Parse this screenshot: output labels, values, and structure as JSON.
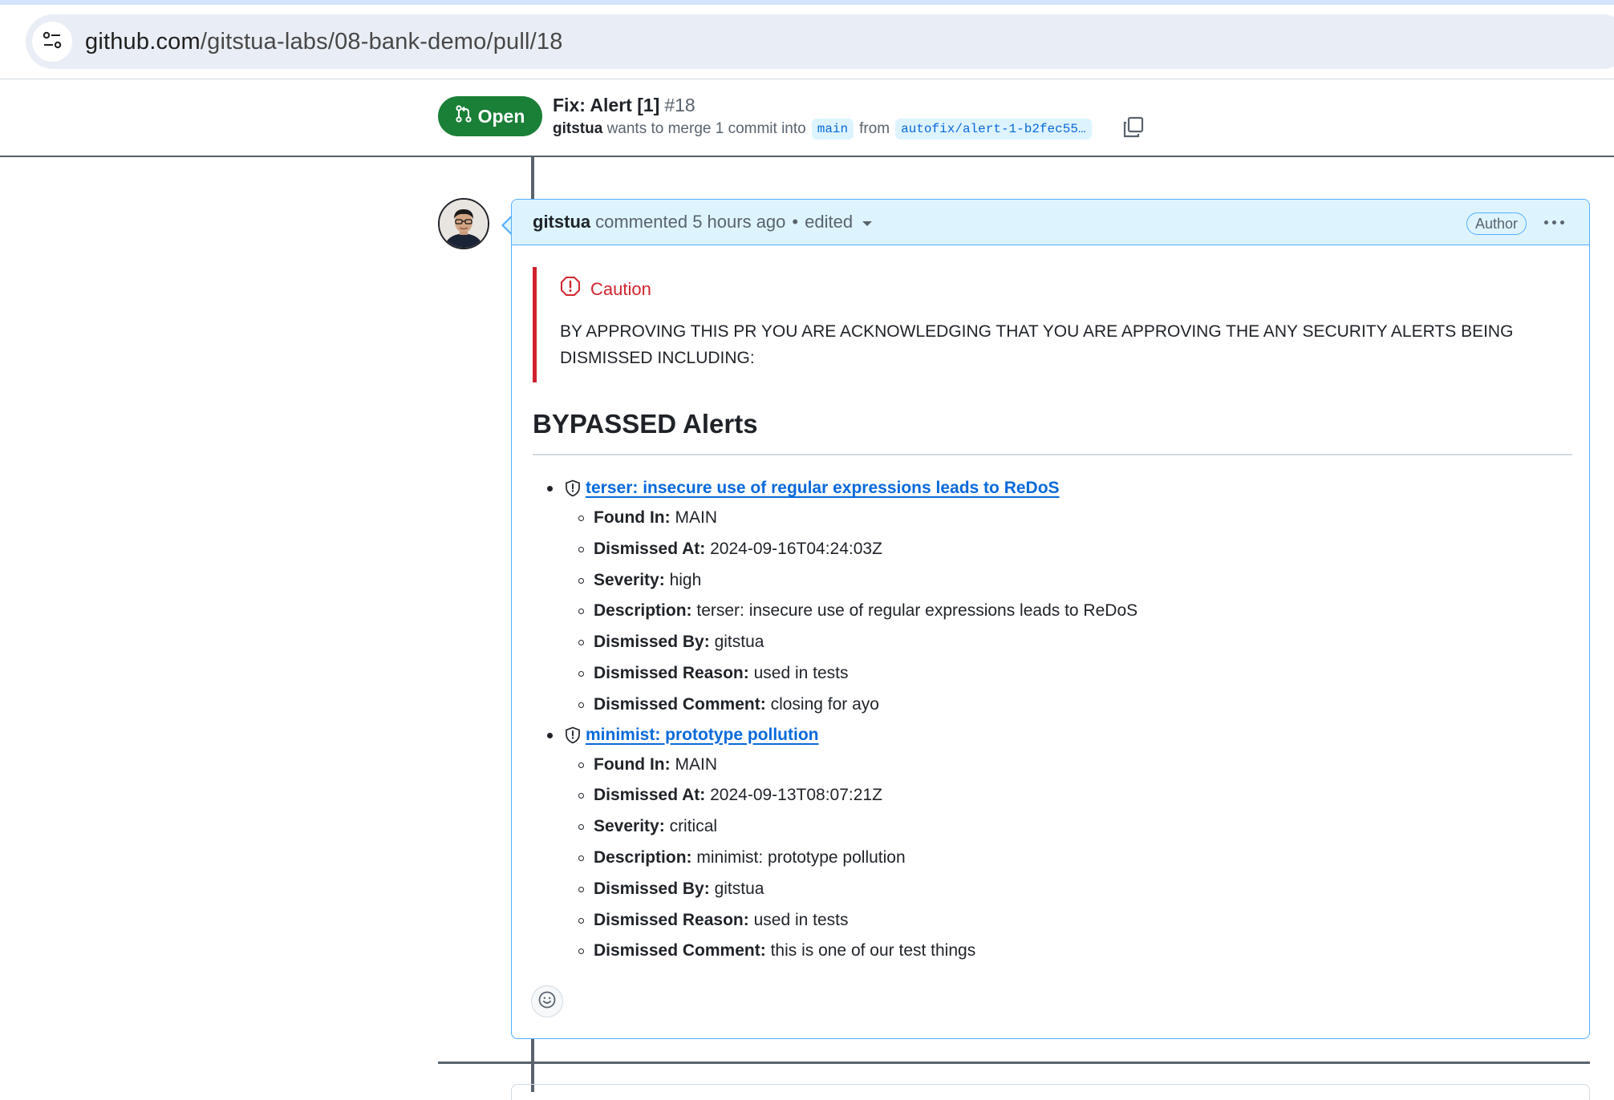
{
  "browser": {
    "url_host": "github.com",
    "url_path": "/gitstua-labs/08-bank-demo/pull/18"
  },
  "pr": {
    "state": "Open",
    "title": "Fix: Alert [1]",
    "number": "#18",
    "author": "gitstua",
    "merge_text": "wants to merge 1 commit into",
    "base_branch": "main",
    "from_text": "from",
    "head_branch": "autofix/alert-1-b2fec55…"
  },
  "comment": {
    "author": "gitstua",
    "action": "commented",
    "time": "5 hours ago",
    "separator": "•",
    "edited": "edited",
    "badge": "Author",
    "caution_title": "Caution",
    "caution_body": "BY APPROVING THIS PR YOU ARE ACKNOWLEDGING THAT YOU ARE APPROVING THE ANY SECURITY ALERTS BEING DISMISSED INCLUDING:",
    "heading": "BYPASSED Alerts",
    "alerts": [
      {
        "title": "terser: insecure use of regular expressions leads to ReDoS",
        "fields": [
          {
            "k": "Found In:",
            "v": "MAIN"
          },
          {
            "k": "Dismissed At:",
            "v": "2024-09-16T04:24:03Z"
          },
          {
            "k": "Severity:",
            "v": "high"
          },
          {
            "k": "Description:",
            "v": "terser: insecure use of regular expressions leads to ReDoS"
          },
          {
            "k": "Dismissed By:",
            "v": "gitstua"
          },
          {
            "k": "Dismissed Reason:",
            "v": "used in tests"
          },
          {
            "k": "Dismissed Comment:",
            "v": "closing for ayo"
          }
        ]
      },
      {
        "title": "minimist: prototype pollution",
        "fields": [
          {
            "k": "Found In:",
            "v": "MAIN"
          },
          {
            "k": "Dismissed At:",
            "v": "2024-09-13T08:07:21Z"
          },
          {
            "k": "Severity:",
            "v": "critical"
          },
          {
            "k": "Description:",
            "v": "minimist: prototype pollution"
          },
          {
            "k": "Dismissed By:",
            "v": "gitstua"
          },
          {
            "k": "Dismissed Reason:",
            "v": "used in tests"
          },
          {
            "k": "Dismissed Comment:",
            "v": "this is one of our test things"
          }
        ]
      }
    ]
  },
  "icons": {
    "site_info": "tune-icon",
    "state": "git-pull-request-icon",
    "copy": "copy-icon",
    "caution": "stop-icon",
    "alert": "shield-icon",
    "reaction": "smiley-icon",
    "menu": "kebab-horizontal-icon"
  },
  "colors": {
    "open_green": "#1a7f37",
    "link_blue": "#0969da",
    "caution_red": "#d1242f",
    "comment_header_bg": "#ddf4ff",
    "comment_border": "#54aeff"
  }
}
